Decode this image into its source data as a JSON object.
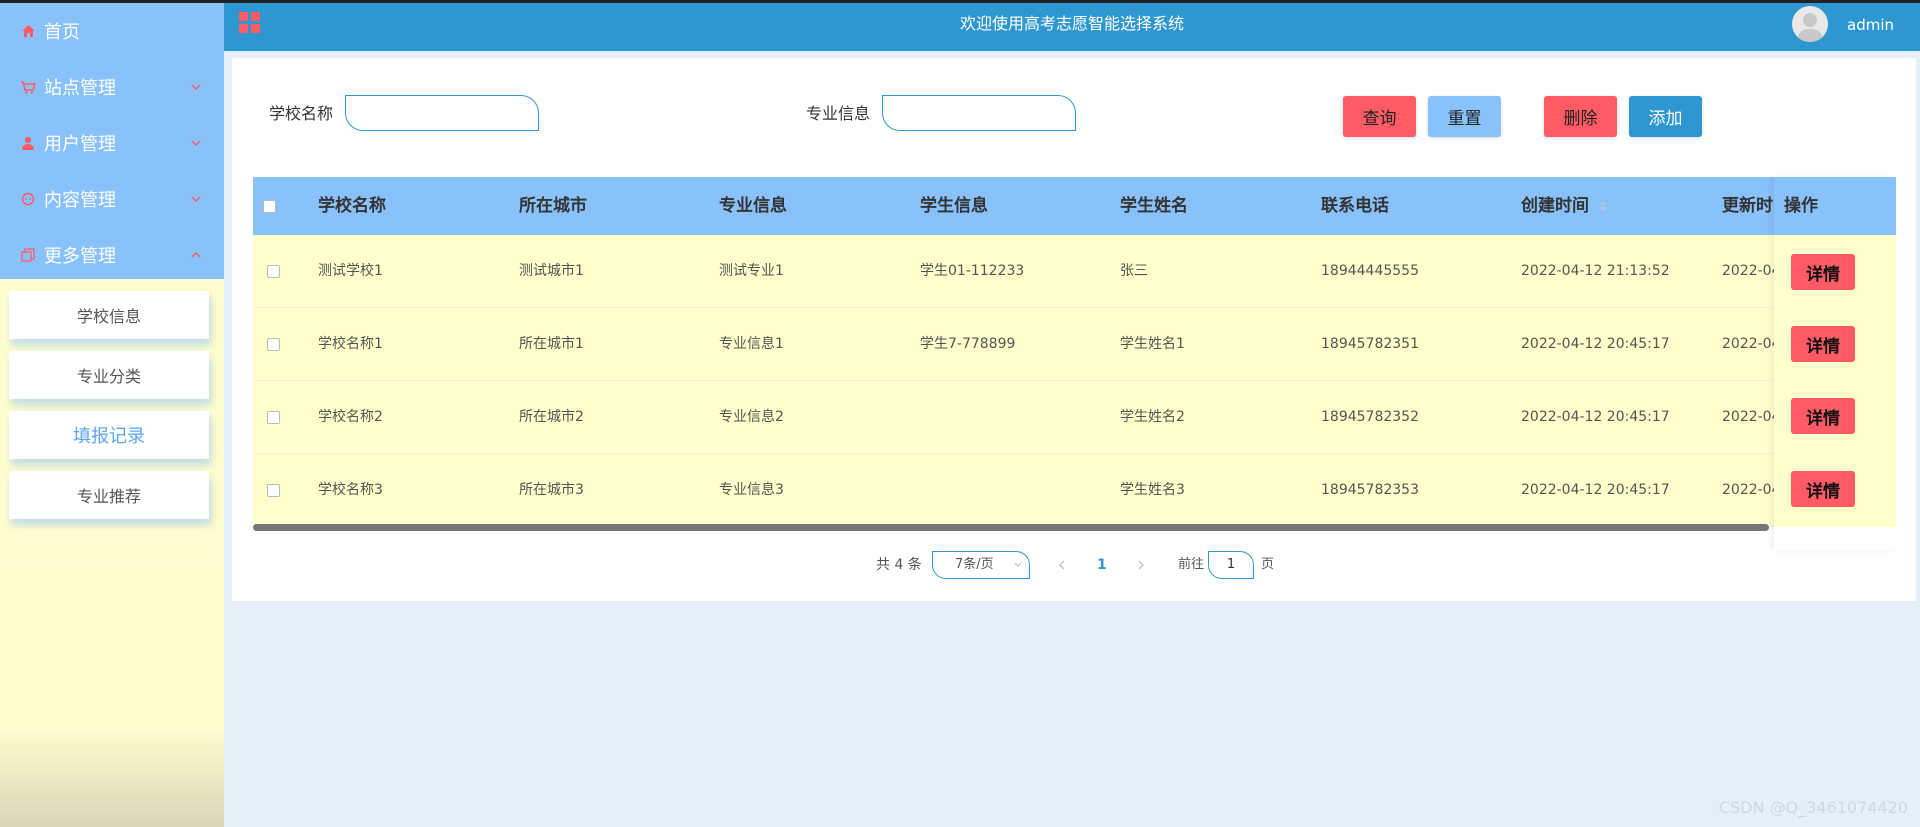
{
  "sidebar": {
    "menu": [
      {
        "label": "首页"
      },
      {
        "label": "站点管理"
      },
      {
        "label": "用户管理"
      },
      {
        "label": "内容管理"
      },
      {
        "label": "更多管理"
      }
    ],
    "submenu": [
      {
        "label": "学校信息"
      },
      {
        "label": "专业分类"
      },
      {
        "label": "填报记录"
      },
      {
        "label": "专业推荐"
      }
    ],
    "active_submenu": "填报记录"
  },
  "header": {
    "title": "欢迎使用高考志愿智能选择系统",
    "user": "admin"
  },
  "search": {
    "school_label": "学校名称",
    "school_value": "",
    "major_label": "专业信息",
    "major_value": "",
    "query_btn": "查询",
    "reset_btn": "重置",
    "delete_btn": "删除",
    "add_btn": "添加"
  },
  "table": {
    "columns": [
      "学校名称",
      "所在城市",
      "专业信息",
      "学生信息",
      "学生姓名",
      "联系电话",
      "创建时间",
      "更新时间",
      "操作"
    ],
    "rows": [
      {
        "school": "测试学校1",
        "city": "测试城市1",
        "major": "测试专业1",
        "student_info": "学生01-112233",
        "name": "张三",
        "phone": "18944445555",
        "created": "2022-04-12 21:13:52",
        "updated": "2022-04-"
      },
      {
        "school": "学校名称1",
        "city": "所在城市1",
        "major": "专业信息1",
        "student_info": "学生7-778899",
        "name": "学生姓名1",
        "phone": "18945782351",
        "created": "2022-04-12 20:45:17",
        "updated": "2022-04-"
      },
      {
        "school": "学校名称2",
        "city": "所在城市2",
        "major": "专业信息2",
        "student_info": "",
        "name": "学生姓名2",
        "phone": "18945782352",
        "created": "2022-04-12 20:45:17",
        "updated": "2022-04-"
      },
      {
        "school": "学校名称3",
        "city": "所在城市3",
        "major": "专业信息3",
        "student_info": "",
        "name": "学生姓名3",
        "phone": "18945782353",
        "created": "2022-04-12 20:45:17",
        "updated": "2022-04-"
      }
    ],
    "detail_btn": "详情"
  },
  "pagination": {
    "total": "共 4 条",
    "page_size": "7条/页",
    "current_page": "1",
    "goto_label": "前往",
    "goto_value": "1",
    "page_unit": "页"
  },
  "watermark": "CSDN @Q_3461074420",
  "colors": {
    "sidebar_menu": "#89c1fb",
    "header": "#2f97d0",
    "row_bg": "#ffffcc",
    "danger": "#ff5b65",
    "reset": "#89c1fb",
    "add": "#2f97d0"
  }
}
